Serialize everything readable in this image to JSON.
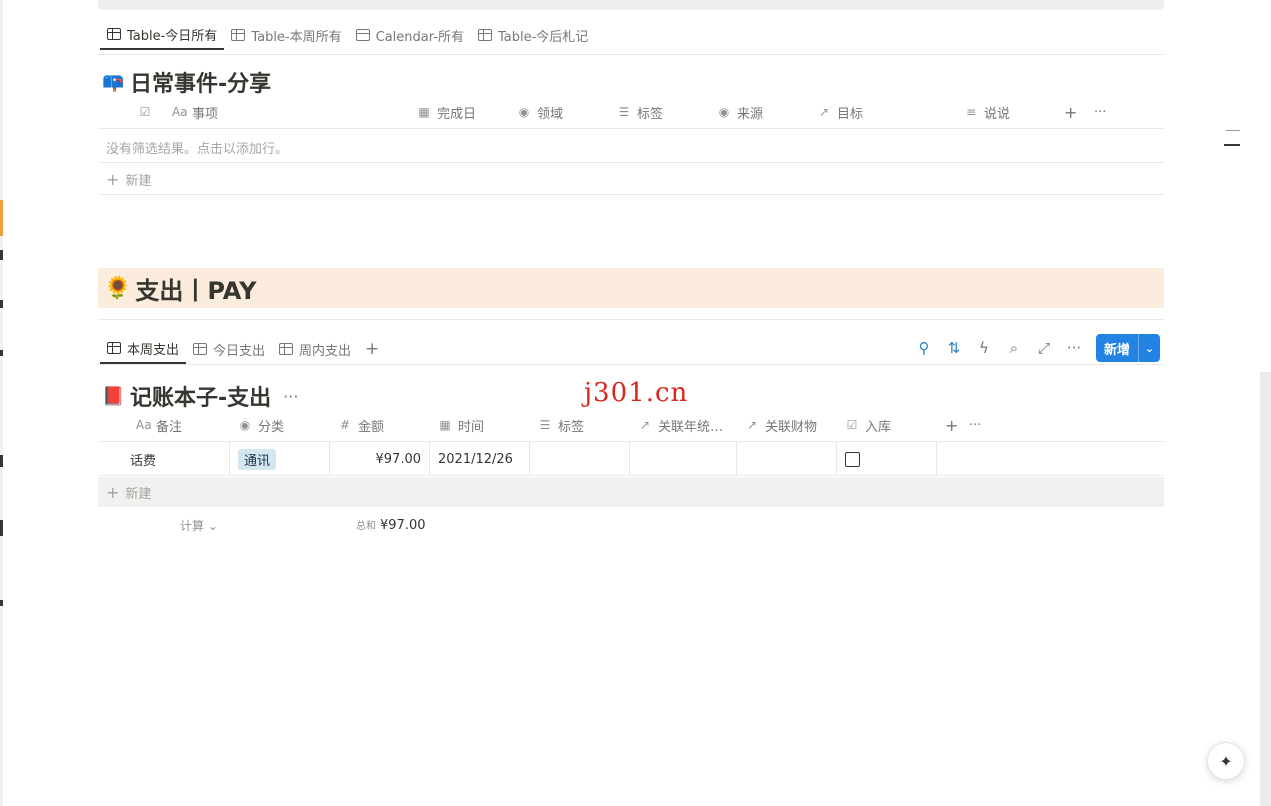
{
  "section1": {
    "tabs": [
      {
        "label": "Table-今日所有",
        "icon": "table-icon",
        "active": true
      },
      {
        "label": "Table-本周所有",
        "icon": "table-icon",
        "active": false
      },
      {
        "label": "Calendar-所有",
        "icon": "calendar-icon",
        "active": false
      },
      {
        "label": "Table-今后札记",
        "icon": "table-icon",
        "active": false
      }
    ],
    "db_title": "日常事件-分享",
    "db_title_emoji": "📪",
    "columns": [
      {
        "icon": "☑",
        "label": ""
      },
      {
        "icon": "Aa",
        "label": "事项"
      },
      {
        "icon": "▦",
        "label": "完成日"
      },
      {
        "icon": "◉",
        "label": "领域"
      },
      {
        "icon": "☰",
        "label": "标签"
      },
      {
        "icon": "◉",
        "label": "来源"
      },
      {
        "icon": "↗",
        "label": "目标"
      },
      {
        "icon": "≡",
        "label": "说说"
      }
    ],
    "add_col": "+",
    "more": "···",
    "empty_text": "没有筛选结果。点击以添加行。",
    "new_label": "新建"
  },
  "callout": {
    "emoji": "🌻",
    "text": "支出丨PAY"
  },
  "section2": {
    "tabs": [
      {
        "label": "本周支出",
        "icon": "table-icon",
        "active": true
      },
      {
        "label": "今日支出",
        "icon": "table-icon",
        "active": false
      },
      {
        "label": "周内支出",
        "icon": "table-icon",
        "active": false
      }
    ],
    "add_tab": "+",
    "toolbar": {
      "filter": "⚲",
      "sort": "⇅",
      "automation": "ϟ",
      "search": "⌕",
      "expand": "⤢",
      "more": "···",
      "new_label": "新增",
      "new_chevron": "⌄"
    },
    "db_title": "记账本子-支出",
    "db_title_emoji": "📕",
    "db_more": "···",
    "columns": [
      {
        "icon": "Aa",
        "label": "备注"
      },
      {
        "icon": "◉",
        "label": "分类"
      },
      {
        "icon": "#",
        "label": "金额"
      },
      {
        "icon": "▦",
        "label": "时间"
      },
      {
        "icon": "☰",
        "label": "标签"
      },
      {
        "icon": "↗",
        "label": "关联年统…"
      },
      {
        "icon": "↗",
        "label": "关联财物"
      },
      {
        "icon": "☑",
        "label": "入库"
      }
    ],
    "add_col": "+",
    "more": "···",
    "rows": [
      {
        "note": "话费",
        "category": "通讯",
        "amount": "¥97.00",
        "date": "2021/12/26",
        "tags": "",
        "year_link": "",
        "asset_link": "",
        "stored": false
      }
    ],
    "new_label": "新建",
    "calc_label": "计算 ⌄",
    "sum_key": "总和",
    "sum_value": "¥97.00"
  },
  "watermark": "j301.cn",
  "ai_button": "✦"
}
